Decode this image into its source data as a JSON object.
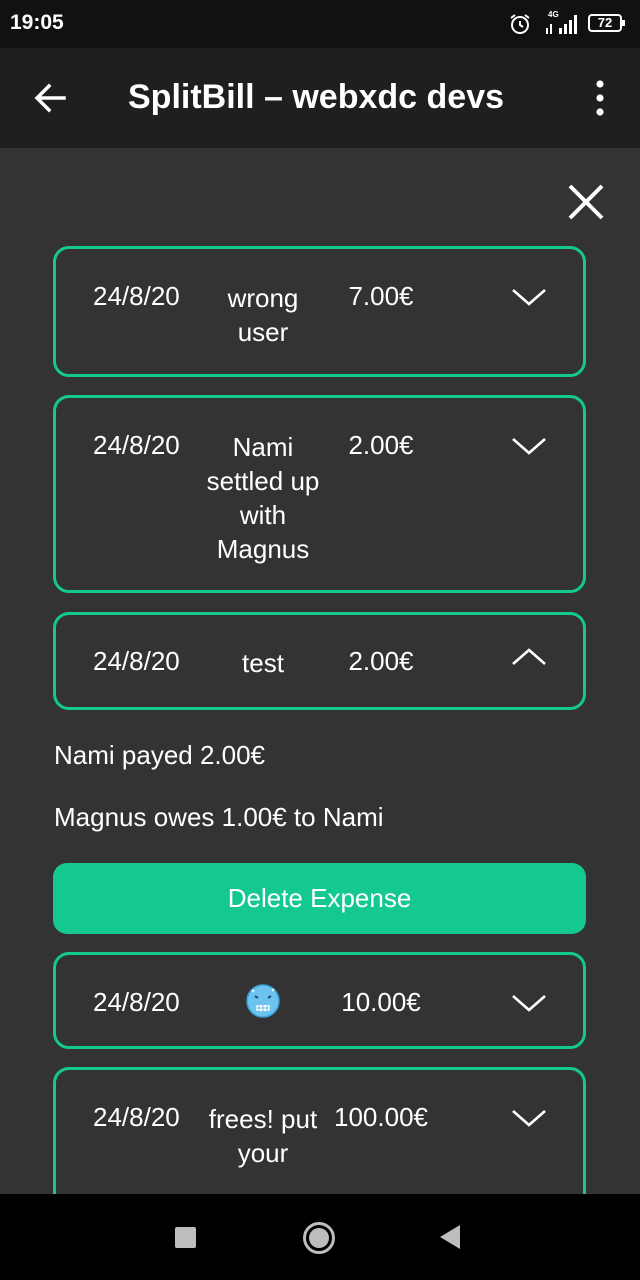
{
  "status_bar": {
    "time": "19:05",
    "network_label": "4G",
    "battery": "72"
  },
  "app_bar": {
    "title": "SplitBill – webxdc devs"
  },
  "expenses": [
    {
      "date": "24/8/20",
      "description": "wrong user",
      "amount": "7.00€",
      "expanded": false
    },
    {
      "date": "24/8/20",
      "description": "Nami settled up with Magnus",
      "amount": "2.00€",
      "expanded": false
    },
    {
      "date": "24/8/20",
      "description": "test",
      "amount": "2.00€",
      "expanded": true
    },
    {
      "date": "24/8/20",
      "description": "🥶",
      "amount": "10.00€",
      "expanded": false
    },
    {
      "date": "24/8/20",
      "description": "frees! put your",
      "amount": "100.00€",
      "expanded": false
    }
  ],
  "expanded_details": {
    "payer_line": "Nami payed 2.00€",
    "debt_line": "Magnus owes 1.00€ to Nami",
    "delete_label": "Delete Expense"
  },
  "colors": {
    "accent": "#13c990",
    "background": "#333333",
    "app_bar": "#1f1f1f",
    "status_bar": "#111111"
  },
  "icons": [
    "back-arrow-icon",
    "more-vert-icon",
    "close-icon",
    "chevron-down-icon",
    "chevron-up-icon",
    "cold-face-emoji",
    "nav-recents-icon",
    "nav-home-icon",
    "nav-back-icon"
  ]
}
